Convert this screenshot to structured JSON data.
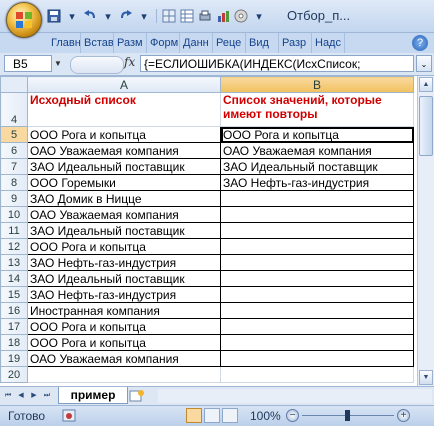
{
  "window": {
    "title": "Отбор_п..."
  },
  "ribbon": {
    "tabs": [
      "Главн",
      "Встав",
      "Разм",
      "Форм",
      "Данн",
      "Реце",
      "Вид",
      "Разр",
      "Надс"
    ],
    "help": "?"
  },
  "formula_bar": {
    "name_box": "B5",
    "fx": "fx",
    "formula": "{=ЕСЛИОШИБКА(ИНДЕКС(ИсхСписок;"
  },
  "columns": [
    "A",
    "B"
  ],
  "rows": [
    {
      "n": "4",
      "a": "Исходный список",
      "b": "Список значений, которые имеют повторы"
    },
    {
      "n": "5",
      "a": "ООО Рога и копытца",
      "b": "ООО Рога и копытца"
    },
    {
      "n": "6",
      "a": "ОАО Уважаемая компания",
      "b": "ОАО Уважаемая компания"
    },
    {
      "n": "7",
      "a": "ЗАО Идеальный поставщик",
      "b": "ЗАО Идеальный поставщик"
    },
    {
      "n": "8",
      "a": "ООО Горемыки",
      "b": "ЗАО Нефть-газ-индустрия"
    },
    {
      "n": "9",
      "a": "ЗАО Домик в Ницце",
      "b": ""
    },
    {
      "n": "10",
      "a": "ОАО Уважаемая компания",
      "b": ""
    },
    {
      "n": "11",
      "a": "ЗАО Идеальный поставщик",
      "b": ""
    },
    {
      "n": "12",
      "a": "ООО Рога и копытца",
      "b": ""
    },
    {
      "n": "13",
      "a": "ЗАО Нефть-газ-индустрия",
      "b": ""
    },
    {
      "n": "14",
      "a": "ЗАО Идеальный поставщик",
      "b": ""
    },
    {
      "n": "15",
      "a": "ЗАО Нефть-газ-индустрия",
      "b": ""
    },
    {
      "n": "16",
      "a": "Иностранная компания",
      "b": ""
    },
    {
      "n": "17",
      "a": "ООО Рога и копытца",
      "b": ""
    },
    {
      "n": "18",
      "a": "ООО Рога и копытца",
      "b": ""
    },
    {
      "n": "19",
      "a": "ОАО Уважаемая компания",
      "b": ""
    },
    {
      "n": "20",
      "a": "",
      "b": ""
    }
  ],
  "sheet_tabs": {
    "active": "пример"
  },
  "status": {
    "text": "Готово",
    "zoom": "100%"
  },
  "colors": {
    "header_text": "#d00000",
    "selection": "#f9d99f"
  }
}
